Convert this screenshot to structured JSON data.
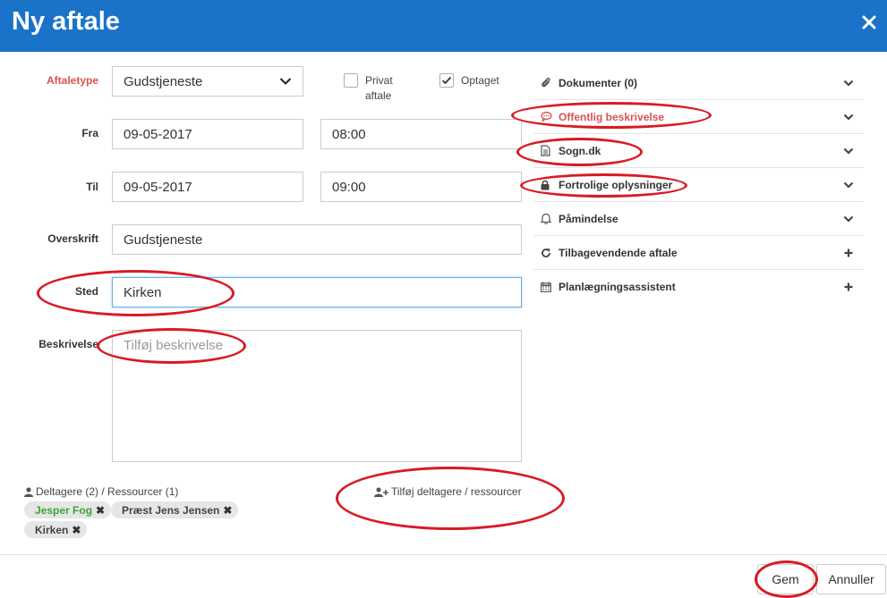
{
  "dialog": {
    "title": "Ny aftale"
  },
  "form": {
    "aftaletype": {
      "label": "Aftaletype",
      "value": "Gudstjeneste"
    },
    "privat": {
      "label_line1": "Privat",
      "label_line2": "aftale",
      "checked": false
    },
    "optaget": {
      "label": "Optaget",
      "checked": true
    },
    "fra": {
      "label": "Fra",
      "date": "09-05-2017",
      "time": "08:00"
    },
    "til": {
      "label": "Til",
      "date": "09-05-2017",
      "time": "09:00"
    },
    "overskrift": {
      "label": "Overskrift",
      "value": "Gudstjeneste"
    },
    "sted": {
      "label": "Sted",
      "value": "Kirken"
    },
    "beskrivelse": {
      "label": "Beskrivelse",
      "placeholder": "Tilføj beskrivelse"
    }
  },
  "participants": {
    "summary": "Deltagere (2) / Ressourcer (1)",
    "add_label": "Tilføj deltagere / ressourcer",
    "tags": [
      {
        "label": "Jesper Fog",
        "color": "#3aa53a"
      },
      {
        "label": "Præst Jens Jensen",
        "color": "#444444"
      },
      {
        "label": "Kirken",
        "color": "#444444"
      }
    ]
  },
  "sidebar": {
    "items": [
      {
        "label": "Dokumenter (0)",
        "icon": "paperclip-icon",
        "indicator": "chevron"
      },
      {
        "label": "Offentlig beskrivelse",
        "icon": "speech-bubble-icon",
        "indicator": "chevron",
        "color": "#d9534f"
      },
      {
        "label": "Sogn.dk",
        "icon": "document-icon",
        "indicator": "chevron"
      },
      {
        "label": "Fortrolige oplysninger",
        "icon": "lock-icon",
        "indicator": "chevron"
      },
      {
        "label": "Påmindelse",
        "icon": "bell-icon",
        "indicator": "chevron"
      },
      {
        "label": "Tilbagevendende aftale",
        "icon": "refresh-icon",
        "indicator": "plus"
      },
      {
        "label": "Planlægningsassistent",
        "icon": "calendar-icon",
        "indicator": "plus"
      }
    ]
  },
  "footer": {
    "save_label": "Gem",
    "cancel_label": "Annuller"
  },
  "colors": {
    "header": "#1a73c9",
    "accent_red": "#d9534f",
    "annotation_red": "#d81b25",
    "green": "#3aa53a"
  }
}
